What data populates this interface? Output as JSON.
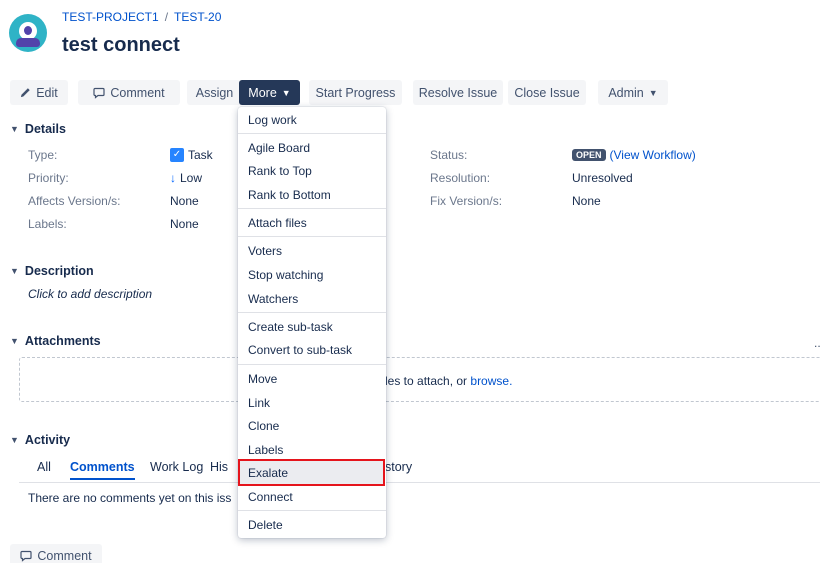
{
  "breadcrumb": {
    "project": "TEST-PROJECT1",
    "separator": "/",
    "issue_key": "TEST-20"
  },
  "page_title": "test connect",
  "toolbar": {
    "edit": "Edit",
    "comment": "Comment",
    "assign": "Assign",
    "more": "More",
    "start_progress": "Start Progress",
    "resolve_issue": "Resolve Issue",
    "close_issue": "Close Issue",
    "admin": "Admin"
  },
  "details": {
    "heading": "Details",
    "type_label": "Type:",
    "type_value": "Task",
    "priority_label": "Priority:",
    "priority_value": "Low",
    "affects_label": "Affects Version/s:",
    "affects_value": "None",
    "labels_label": "Labels:",
    "labels_value": "None",
    "status_label": "Status:",
    "status_value": "OPEN",
    "workflow_link": "(View Workflow)",
    "resolution_label": "Resolution:",
    "resolution_value": "Unresolved",
    "fix_label": "Fix Version/s:",
    "fix_value": "None"
  },
  "description": {
    "heading": "Description",
    "placeholder": "Click to add description"
  },
  "attachments": {
    "heading": "Attachments",
    "drop_text": "les to attach, or",
    "browse_link": "browse.",
    "more": "..."
  },
  "activity": {
    "heading": "Activity",
    "tabs": [
      "All",
      "Comments",
      "Work Log",
      "His",
      "story"
    ],
    "empty_text": "There are no comments yet on this iss"
  },
  "bottom_comment_button": "Comment",
  "more_menu": {
    "items": [
      "Log work",
      "Agile Board",
      "Rank to Top",
      "Rank to Bottom",
      "Attach files",
      "Voters",
      "Stop watching",
      "Watchers",
      "Create sub-task",
      "Convert to sub-task",
      "Move",
      "Link",
      "Clone",
      "Labels",
      "Exalate",
      "Connect",
      "Delete"
    ]
  },
  "colors": {
    "accent": "#0052cc",
    "active_button": "#253858",
    "highlight_border": "#e5141c"
  }
}
